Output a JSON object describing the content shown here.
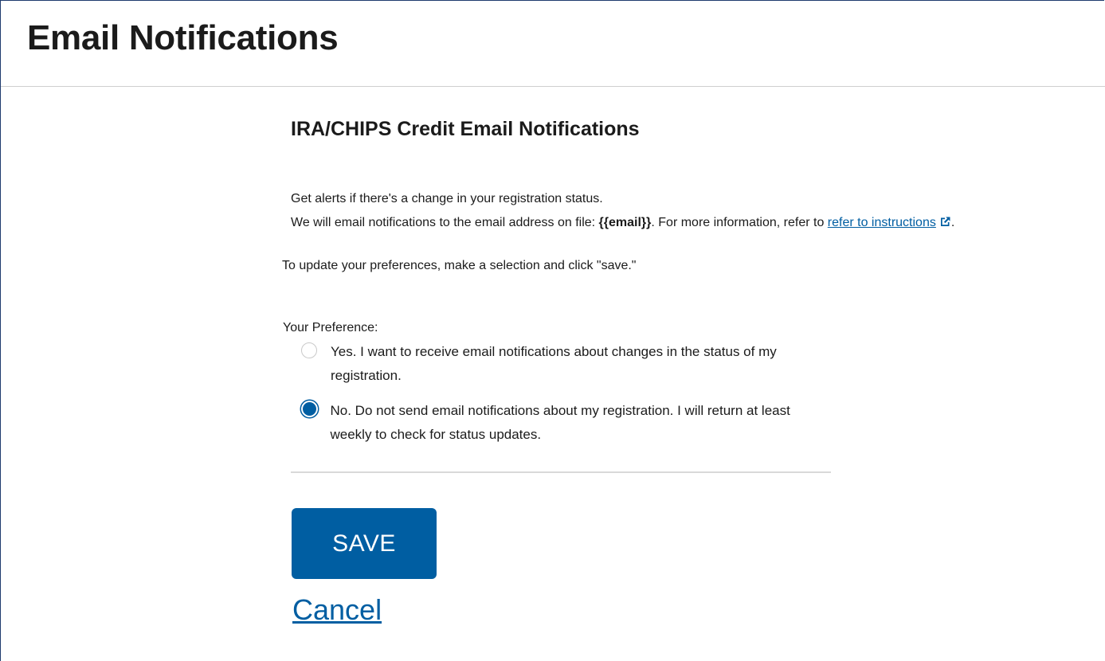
{
  "page": {
    "title": "Email Notifications"
  },
  "section": {
    "title": "IRA/CHIPS Credit Email Notifications"
  },
  "intro": {
    "line1": "Get alerts if there's a change in your registration status.",
    "line2_prefix": "We will email notifications to the email address on file: ",
    "email_placeholder": "{{email}}",
    "line2_middle": ". For more  information, refer to ",
    "link_text": "refer to instructions",
    "line2_suffix": ".",
    "link_icon": "external-link-icon"
  },
  "instructions": "To update your preferences, make a selection and click \"save.\"",
  "preference": {
    "legend": "Your Preference:",
    "options": [
      {
        "label": "Yes. I want to receive email notifications about changes in the status of my registration.",
        "selected": false
      },
      {
        "label": "No. Do not send email notifications about my registration. I will return at least weekly to check for status updates.",
        "selected": true
      }
    ]
  },
  "actions": {
    "save_label": "SAVE",
    "cancel_label": "Cancel"
  },
  "colors": {
    "primary": "#005ea2",
    "text": "#1b1b1b",
    "divider": "#d9d9d9"
  }
}
